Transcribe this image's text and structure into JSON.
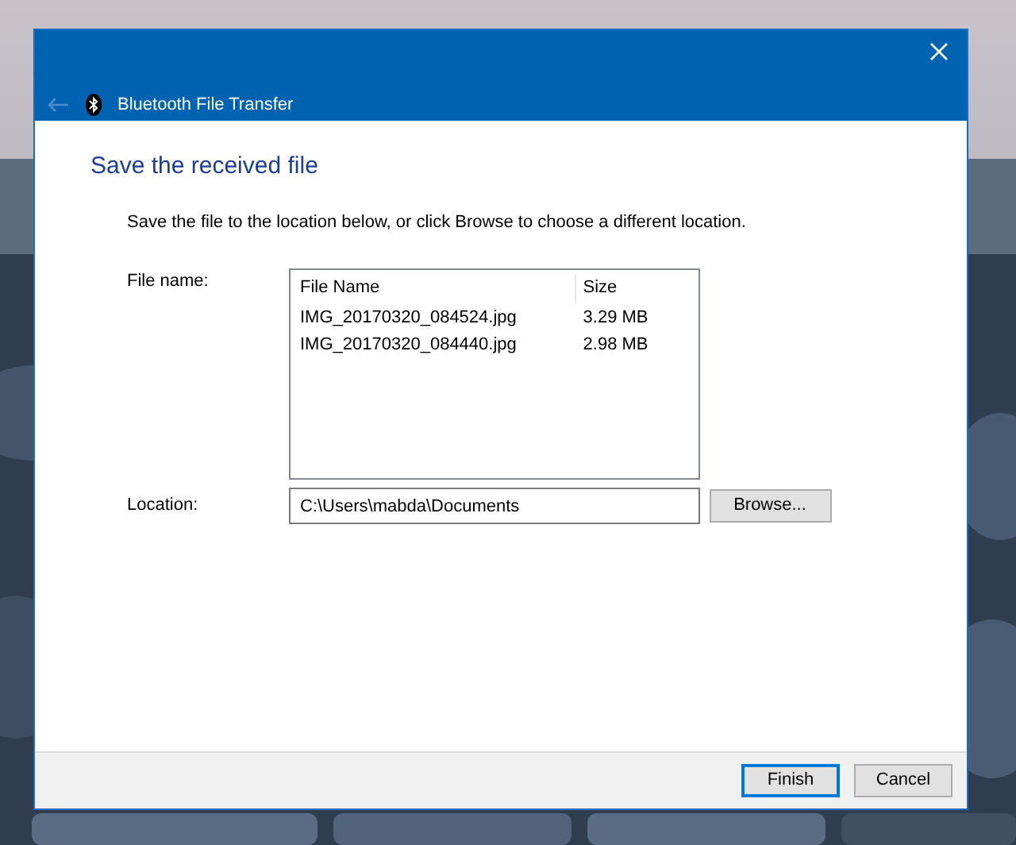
{
  "window": {
    "title": "Bluetooth File Transfer",
    "back_button": {
      "disabled": true
    }
  },
  "heading": "Save the received file",
  "instruction": "Save the file to the location below, or click Browse to choose a different location.",
  "file_list": {
    "label": "File name:",
    "columns": [
      "File Name",
      "Size"
    ],
    "rows": [
      {
        "name": "IMG_20170320_084524.jpg",
        "size": "3.29 MB"
      },
      {
        "name": "IMG_20170320_084440.jpg",
        "size": "2.98 MB"
      }
    ]
  },
  "location": {
    "label": "Location:",
    "value": "C:\\Users\\mabda\\Documents",
    "button": "Browse..."
  },
  "buttons": [
    {
      "label": "Finish",
      "default": true
    },
    {
      "label": "Cancel",
      "default": false
    }
  ]
}
